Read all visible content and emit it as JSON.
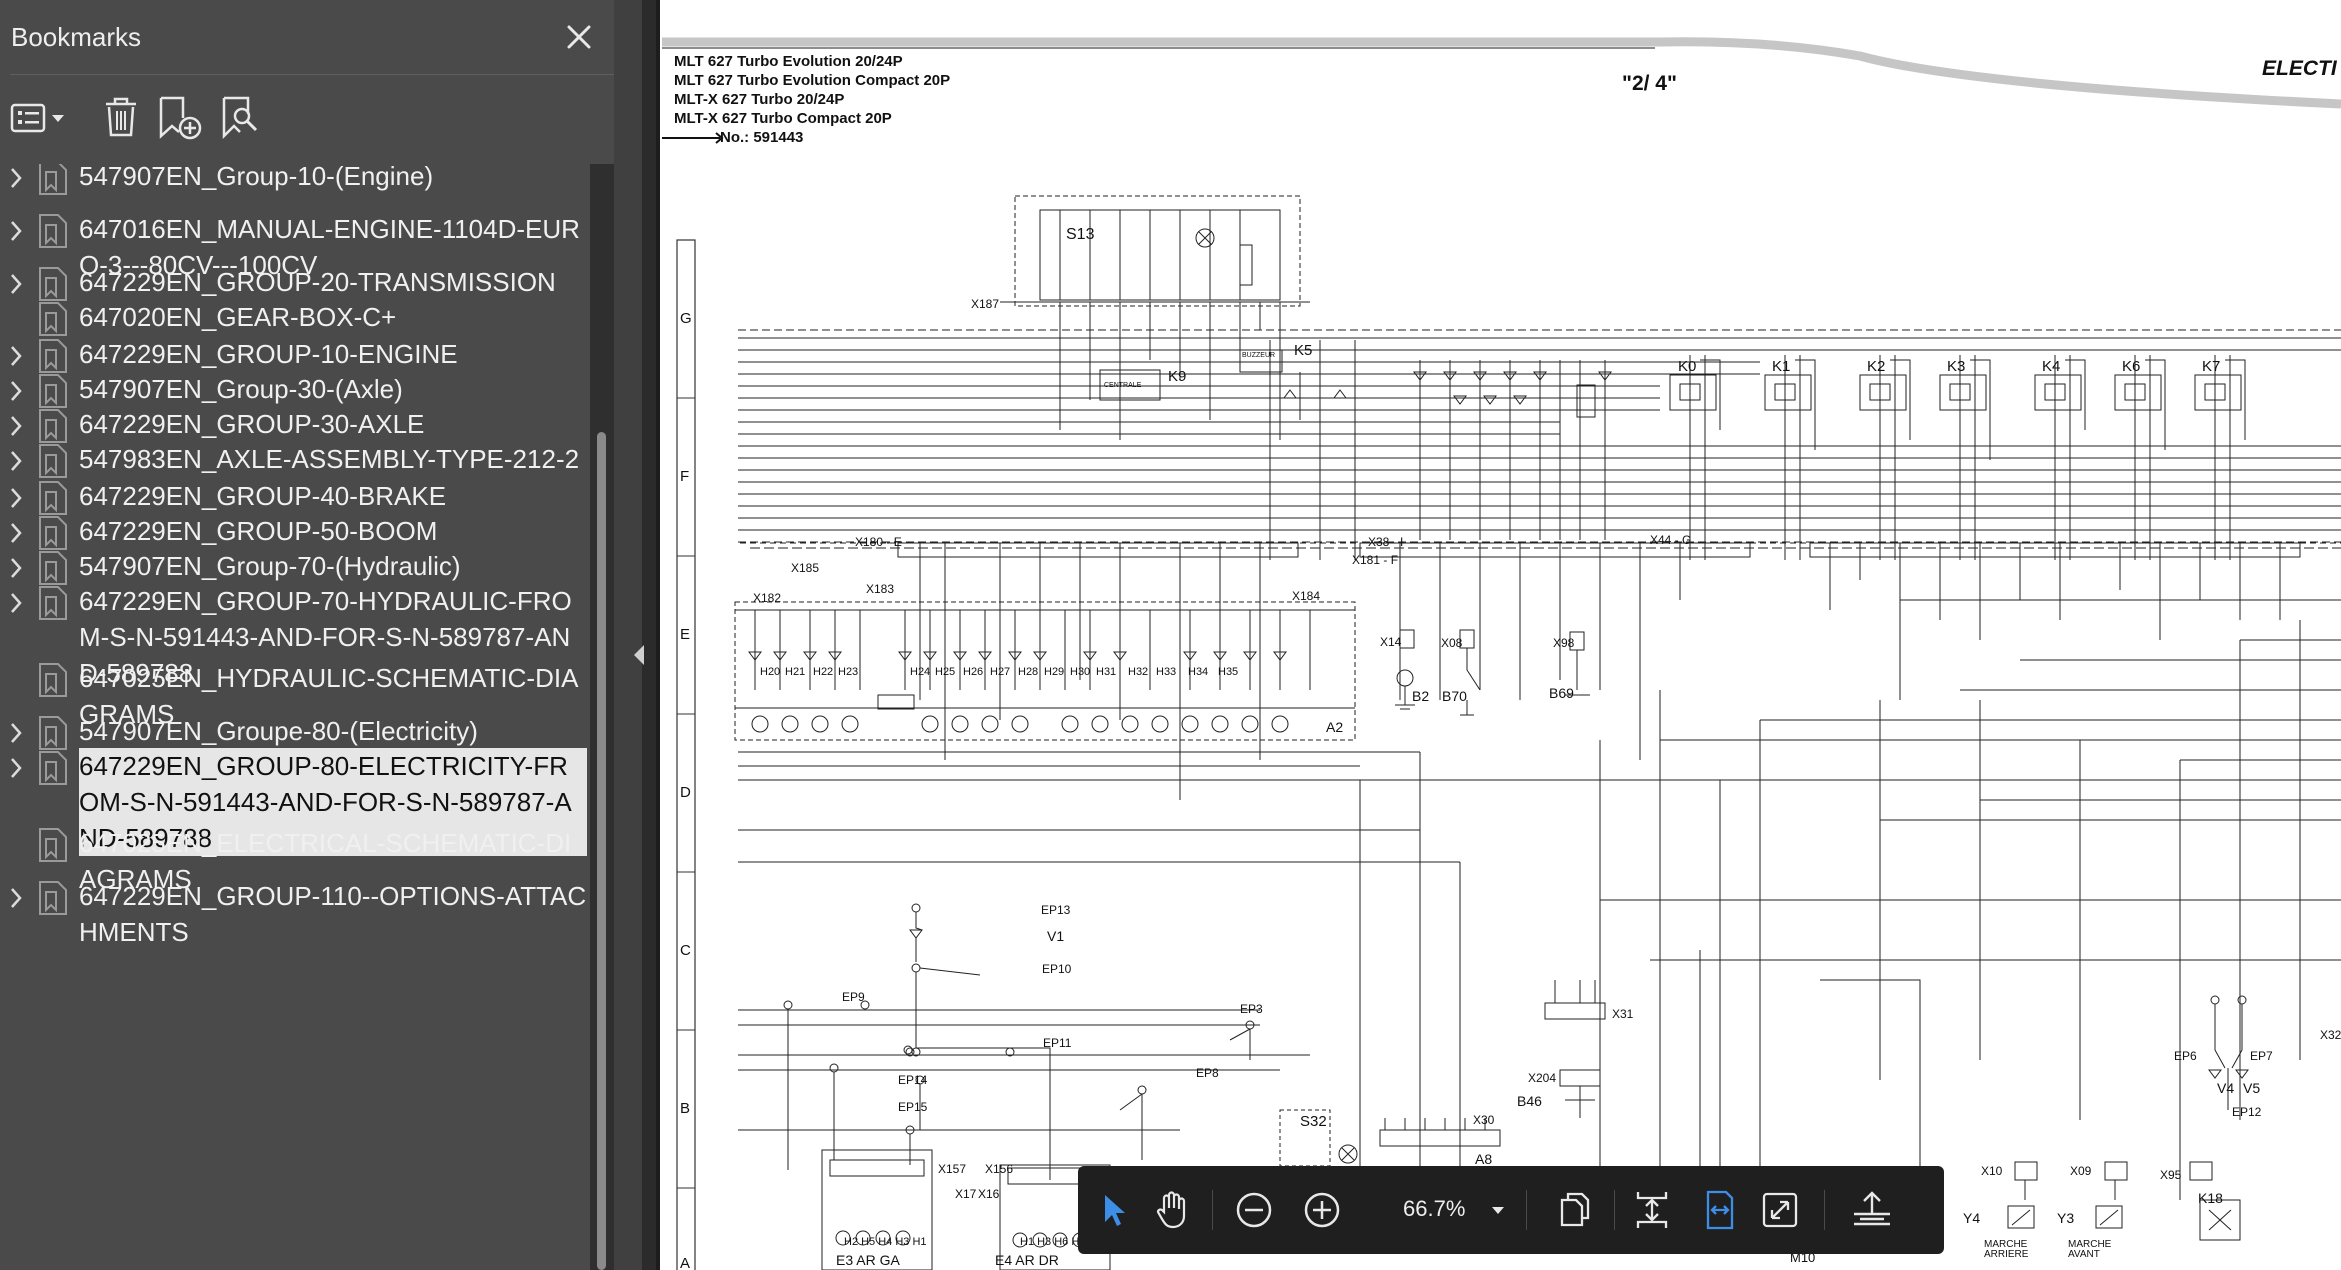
{
  "sidebar": {
    "title": "Bookmarks",
    "items": [
      {
        "label": "547907EN_Group-10-(Engine)",
        "expandable": true
      },
      {
        "label": "647016EN_MANUAL-ENGINE-1104D-EURO-3---80CV---100CV",
        "expandable": true
      },
      {
        "label": "647229EN_GROUP-20-TRANSMISSION",
        "expandable": true
      },
      {
        "label": "647020EN_GEAR-BOX-C+",
        "expandable": false
      },
      {
        "label": "647229EN_GROUP-10-ENGINE",
        "expandable": true
      },
      {
        "label": "547907EN_Group-30-(Axle)",
        "expandable": true
      },
      {
        "label": "647229EN_GROUP-30-AXLE",
        "expandable": true
      },
      {
        "label": "547983EN_AXLE-ASSEMBLY-TYPE-212-2",
        "expandable": true
      },
      {
        "label": "647229EN_GROUP-40-BRAKE",
        "expandable": true
      },
      {
        "label": "647229EN_GROUP-50-BOOM",
        "expandable": true
      },
      {
        "label": "547907EN_Group-70-(Hydraulic)",
        "expandable": true
      },
      {
        "label": "647229EN_GROUP-70-HYDRAULIC-FROM-S-N-591443-AND-FOR-S-N-589787-AND-589788",
        "expandable": true
      },
      {
        "label": "647025EN_HYDRAULIC-SCHEMATIC-DIAGRAMS",
        "expandable": false
      },
      {
        "label": "547907EN_Groupe-80-(Electricity)",
        "expandable": true
      },
      {
        "label": "647229EN_GROUP-80-ELECTRICITY-FROM-S-N-591443-AND-FOR-S-N-589787-AND-589788",
        "expandable": true,
        "selected": true
      },
      {
        "label": "647025EN_ELECTRICAL-SCHEMATIC-DIAGRAMS",
        "expandable": false
      },
      {
        "label": "647229EN_GROUP-110--OPTIONS-ATTACHMENTS",
        "expandable": true
      }
    ]
  },
  "document": {
    "header_lines": [
      "MLT 627 Turbo Evolution 20/24P",
      "MLT 627 Turbo Evolution Compact 20P",
      "MLT-X 627 Turbo 20/24P",
      "MLT-X 627 Turbo Compact 20P"
    ],
    "serial": "No.: 591443",
    "page_label": "\"2/ 4\"",
    "section_label": "ELECTI",
    "row_letters": [
      "G",
      "F",
      "E",
      "D",
      "C",
      "B",
      "A"
    ],
    "components": {
      "s13": "S13",
      "x187": "X187",
      "k5": "K5",
      "k9": "K9",
      "buzzer": "BUZZEUR",
      "centrale": "CENTRALE",
      "relays": [
        "K0",
        "K1",
        "K2",
        "K3",
        "K4",
        "K6",
        "K7"
      ],
      "x180": "X180 - E",
      "x38": "X38 - I",
      "x181": "X181 - F",
      "x44": "X44 - G",
      "x185": "X185",
      "x183": "X183",
      "x182": "X182",
      "x184": "X184",
      "lamps": [
        "H20",
        "H21",
        "H22",
        "H23",
        "H24",
        "H25",
        "H26",
        "H27",
        "H28",
        "H29",
        "H30",
        "H31",
        "H32",
        "H33",
        "H34",
        "H35"
      ],
      "a2": "A2",
      "x14": "X14",
      "x08": "X08",
      "x98": "X98",
      "b2": "B2",
      "b70": "B70",
      "b69": "B69",
      "ep13": "EP13",
      "v1": "V1",
      "ep10": "EP10",
      "ep9": "EP9",
      "ep3": "EP3",
      "ep11": "EP11",
      "ep8": "EP8",
      "ep14": "EP14",
      "ep15": "EP15",
      "x31": "X31",
      "x204": "X204",
      "b46": "B46",
      "s32": "S32",
      "x30": "X30",
      "a8": "A8",
      "x157": "X157",
      "x17": "X17",
      "x156": "X156",
      "x16": "X16",
      "e3": "E3 AR GA",
      "e4": "E4 AR DR",
      "h_left": "H2 H5 H4 H3 H1",
      "h_right": "H1 H3 H6 H5",
      "ep6": "EP6",
      "ep7": "EP7",
      "v4": "V4",
      "v5": "V5",
      "ep12": "EP12",
      "x32": "X32",
      "x10": "X10",
      "x09": "X09",
      "x95": "X95",
      "k18": "K18",
      "y4": "Y4",
      "y3": "Y3",
      "marche_arriere": "MARCHE ARRIERE",
      "marche_avant": "MARCHE AVANT",
      "m10": "M10"
    }
  },
  "viewer_toolbar": {
    "zoom": "66.7%"
  }
}
